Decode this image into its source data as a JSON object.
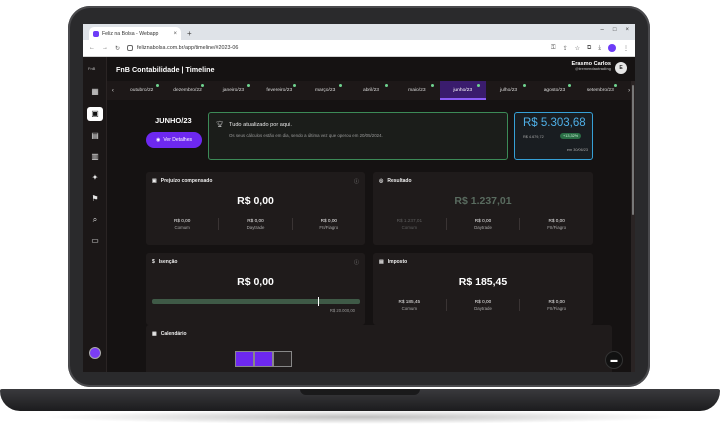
{
  "browser": {
    "tab_title": "Feliz na Bolsa - Webapp",
    "tab_close": "×",
    "new_tab": "+",
    "url": "feliznabolsa.com.br/app/timeline/#2023-06",
    "window_controls": [
      "–",
      "□",
      "×"
    ]
  },
  "sidebar": {
    "logo_text": "FnB",
    "items": [
      {
        "icon": "dashboard-icon",
        "glyph": "▦"
      },
      {
        "icon": "timeline-icon",
        "glyph": "▣",
        "active": true
      },
      {
        "icon": "document-icon",
        "glyph": "▤"
      },
      {
        "icon": "chart-board-icon",
        "glyph": "▥"
      },
      {
        "icon": "magic-icon",
        "glyph": "✦"
      },
      {
        "icon": "flag-icon",
        "glyph": "⚑"
      },
      {
        "icon": "search-money-icon",
        "glyph": "⌕"
      },
      {
        "icon": "archive-icon",
        "glyph": "▭"
      }
    ]
  },
  "header": {
    "title": "FnB Contabilidade | Timeline",
    "user_name": "Erasmo Carlos",
    "user_handle": "@tremendaotrading",
    "user_initial": "E"
  },
  "months": [
    {
      "label": "outubro/22",
      "dot": true
    },
    {
      "label": "dezembro/22",
      "dot": true
    },
    {
      "label": "janeiro/23",
      "dot": true
    },
    {
      "label": "fevereiro/23",
      "dot": true
    },
    {
      "label": "março/23",
      "dot": true
    },
    {
      "label": "abril/23",
      "dot": true
    },
    {
      "label": "maio/23",
      "dot": true
    },
    {
      "label": "junho/23",
      "dot": true,
      "selected": true
    },
    {
      "label": "julho/23",
      "dot": true
    },
    {
      "label": "agosto/23",
      "dot": true
    },
    {
      "label": "setembro/23",
      "dot": true
    }
  ],
  "month_nav": {
    "prev": "‹",
    "next": "›"
  },
  "summary": {
    "month_title": "JUNHO/23",
    "details_button": "Ver Detalhes",
    "status_title": "Tudo atualizado por aqui.",
    "status_desc": "Os seus cálculos estão em dia, sendo a última vez que operou em 20/05/2024.",
    "total_value": "R$ 5.303,68",
    "prev_value": "R$ 4.679,72",
    "change_badge": "+13,32%",
    "total_date": "em 30/06/23"
  },
  "cards": {
    "prejuizo": {
      "title": "Prejuízo compensado",
      "value": "R$ 0,00",
      "cols": [
        {
          "amount": "R$ 0,00",
          "label": "Comum"
        },
        {
          "amount": "R$ 0,00",
          "label": "Daytrade"
        },
        {
          "amount": "R$ 0,00",
          "label": "FII/Fiagro"
        }
      ]
    },
    "resultado": {
      "title": "Resultado",
      "value": "R$ 1.237,01",
      "cols": [
        {
          "amount": "R$ 1.237,01",
          "label": "Comum"
        },
        {
          "amount": "R$ 0,00",
          "label": "Daytrade"
        },
        {
          "amount": "R$ 0,00",
          "label": "FII/Fiagro"
        }
      ]
    },
    "isencao": {
      "title": "Isenção",
      "value": "R$ 0,00",
      "limit": "R$ 20.000,00",
      "progress": 0.8
    },
    "imposto": {
      "title": "Imposto",
      "value": "R$ 185,45",
      "cols": [
        {
          "amount": "R$ 185,45",
          "label": "Comum"
        },
        {
          "amount": "R$ 0,00",
          "label": "Daytrade"
        },
        {
          "amount": "R$ 0,00",
          "label": "FII/Fiagro"
        }
      ]
    },
    "calendario": {
      "title": "Calendário"
    }
  },
  "colors": {
    "accent": "#6d28f0",
    "success": "#3c8a57",
    "info": "#36a0d6"
  }
}
